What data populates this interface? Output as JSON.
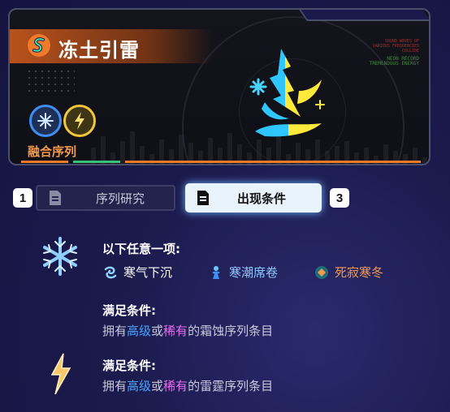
{
  "card": {
    "title": "冻土引雷",
    "fusion_label": "融合序列",
    "small_text_red": [
      "SOUND WAVES OF",
      "VARIOUS FREQUENCIES",
      "COLLIDE"
    ],
    "small_text_green": [
      "NEON RECORD",
      "TREMENDOUS ENERGY"
    ],
    "colors": {
      "accent_orange": "#f07a2c",
      "frost": "#3f8ff0",
      "thunder": "#f2c53a"
    }
  },
  "tabs": [
    {
      "number": "1",
      "label": "序列研究",
      "icon": "document-icon",
      "active": false
    },
    {
      "label": "出现条件",
      "icon": "document-icon",
      "active": true
    },
    {
      "number": "3"
    }
  ],
  "conditions": {
    "any_heading": "以下任意一项:",
    "options": [
      {
        "label": "寒气下沉",
        "icon": "frost-swirl-icon",
        "color": "#ffffff"
      },
      {
        "label": "寒潮席卷",
        "icon": "frost-figure-icon",
        "color": "#8fc8ff"
      },
      {
        "label": "死寂寒冬",
        "icon": "frost-orb-icon",
        "color": "#f49a4e"
      }
    ],
    "frost": {
      "heading": "满足条件:",
      "prefix": "拥有",
      "high": "高级",
      "or": "或",
      "rare": "稀有",
      "suffix": "的霜蚀序列条目"
    },
    "thunder": {
      "heading": "满足条件:",
      "prefix": "拥有",
      "high": "高级",
      "or": "或",
      "rare": "稀有",
      "suffix": "的雷霆序列条目"
    }
  }
}
